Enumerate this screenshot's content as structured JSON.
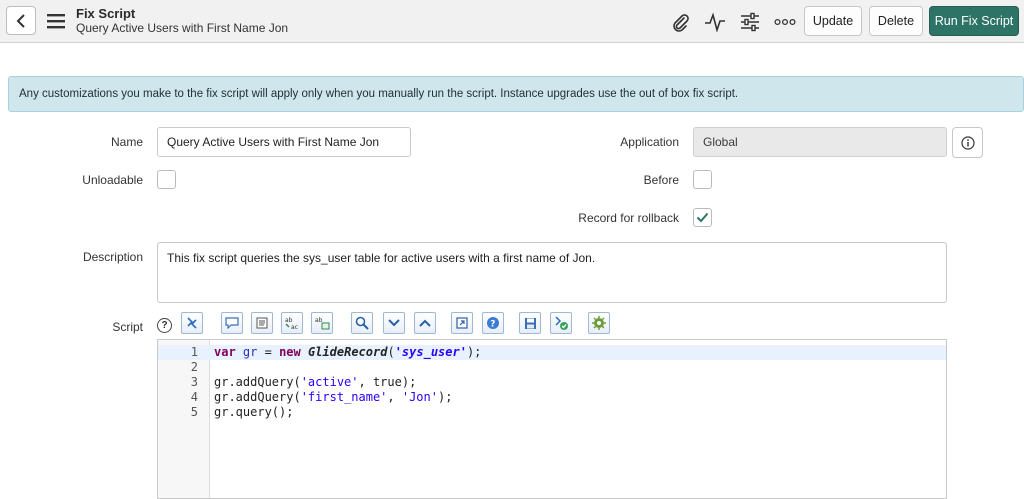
{
  "header": {
    "title": "Fix Script",
    "subtitle": "Query Active Users with First Name Jon",
    "buttons": {
      "update": "Update",
      "delete": "Delete",
      "run": "Run Fix Script"
    },
    "icons": [
      "paperclip-icon",
      "activity-icon",
      "sliders-icon",
      "more-icon"
    ]
  },
  "banner": "Any customizations you make to the fix script will apply only when you manually run the script. Instance upgrades use the out of box fix script.",
  "form": {
    "name_label": "Name",
    "name_value": "Query Active Users with First Name Jon",
    "application_label": "Application",
    "application_value": "Global",
    "unloadable_label": "Unloadable",
    "before_label": "Before",
    "rollback_label": "Record for rollback",
    "rollback_checked": true,
    "description_label": "Description",
    "description_value": "This fix script queries the sys_user table for active users with a first name of Jon.",
    "script_label": "Script"
  },
  "script": {
    "line_numbers": [
      "1",
      "2",
      "3",
      "4",
      "5"
    ],
    "lines": [
      "var gr = new GlideRecord('sys_user');",
      "",
      "gr.addQuery('active', true);",
      "gr.addQuery('first_name', 'Jon');",
      "gr.query();"
    ]
  },
  "colors": {
    "run_button": "#2e7466",
    "banner_bg": "#cfe6ec",
    "checkmark": "#2e7466"
  }
}
